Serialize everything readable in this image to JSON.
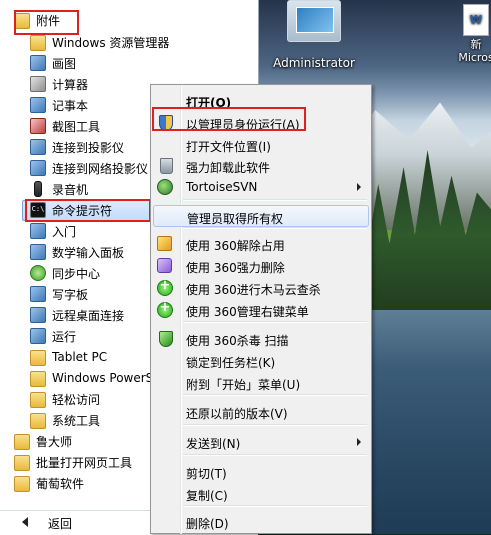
{
  "desktop": {
    "admin_icon_label": "Administrator",
    "doc_icon_label": "新\nMicros",
    "doc_icon_glyph": "W"
  },
  "start_menu": {
    "items": [
      {
        "label": "附件",
        "icon": "folder-icon"
      },
      {
        "label": "Windows 资源管理器",
        "icon": "explorer-icon"
      },
      {
        "label": "画图",
        "icon": "paint-icon"
      },
      {
        "label": "计算器",
        "icon": "calculator-icon"
      },
      {
        "label": "记事本",
        "icon": "notepad-icon"
      },
      {
        "label": "截图工具",
        "icon": "snipping-tool-icon"
      },
      {
        "label": "连接到投影仪",
        "icon": "projector-icon"
      },
      {
        "label": "连接到网络投影仪",
        "icon": "network-projector-icon"
      },
      {
        "label": "录音机",
        "icon": "microphone-icon"
      },
      {
        "label": "命令提示符",
        "icon": "cmd-icon",
        "glyph": "C:\\"
      },
      {
        "label": "入门",
        "icon": "getting-started-icon"
      },
      {
        "label": "数学输入面板",
        "icon": "math-input-icon"
      },
      {
        "label": "同步中心",
        "icon": "sync-center-icon"
      },
      {
        "label": "写字板",
        "icon": "wordpad-icon"
      },
      {
        "label": "远程桌面连接",
        "icon": "remote-desktop-icon"
      },
      {
        "label": "运行",
        "icon": "run-icon"
      },
      {
        "label": "Tablet PC",
        "icon": "folder-icon"
      },
      {
        "label": "Windows PowerS",
        "icon": "folder-icon"
      },
      {
        "label": "轻松访问",
        "icon": "folder-icon"
      },
      {
        "label": "系统工具",
        "icon": "folder-icon"
      },
      {
        "label": "鲁大师",
        "icon": "folder-icon"
      },
      {
        "label": "批量打开网页工具",
        "icon": "folder-icon"
      },
      {
        "label": "葡萄软件",
        "icon": "folder-icon"
      }
    ],
    "back_label": "返回"
  },
  "context_menu": {
    "items": [
      {
        "label": "打开(O)",
        "icon": "",
        "bold": true
      },
      {
        "label": "以管理员身份运行(A)",
        "icon": "uac-shield-icon"
      },
      {
        "label": "打开文件位置(I)",
        "icon": ""
      },
      {
        "label": "强力卸载此软件",
        "icon": "trash-icon"
      },
      {
        "label": "TortoiseSVN",
        "icon": "tortoisesvn-icon",
        "submenu": true
      },
      {
        "label": "管理员取得所有权",
        "icon": ""
      },
      {
        "label": "使用 360解除占用",
        "icon": "unlock-360-icon"
      },
      {
        "label": "使用 360强力删除",
        "icon": "delete-360-icon"
      },
      {
        "label": "使用 360进行木马云查杀",
        "icon": "scan-360-icon"
      },
      {
        "label": "使用 360管理右键菜单",
        "icon": "menu-360-icon"
      },
      {
        "label": "使用 360杀毒 扫描",
        "icon": "antivirus-360-icon"
      },
      {
        "label": "锁定到任务栏(K)",
        "icon": ""
      },
      {
        "label": "附到「开始」菜单(U)",
        "icon": ""
      },
      {
        "label": "还原以前的版本(V)",
        "icon": ""
      },
      {
        "label": "发送到(N)",
        "icon": "",
        "submenu": true
      },
      {
        "label": "剪切(T)",
        "icon": ""
      },
      {
        "label": "复制(C)",
        "icon": ""
      },
      {
        "label": "删除(D)",
        "icon": ""
      }
    ]
  },
  "colors": {
    "annotation_red": "#e0201c",
    "selection_border": "#7da2ce"
  }
}
